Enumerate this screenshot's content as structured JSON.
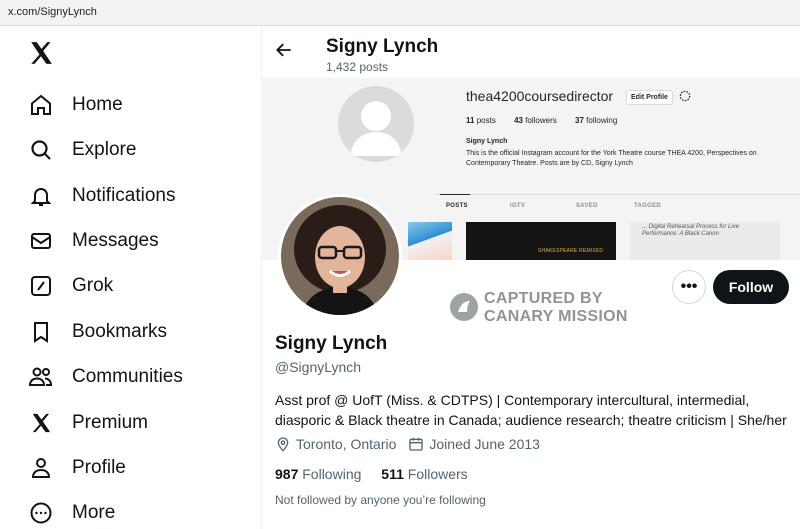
{
  "browser": {
    "url": "x.com/SignyLynch"
  },
  "sidebar": {
    "items": [
      {
        "label": "Home",
        "icon": "home-icon"
      },
      {
        "label": "Explore",
        "icon": "search-icon"
      },
      {
        "label": "Notifications",
        "icon": "bell-icon"
      },
      {
        "label": "Messages",
        "icon": "envelope-icon"
      },
      {
        "label": "Grok",
        "icon": "grok-icon"
      },
      {
        "label": "Bookmarks",
        "icon": "bookmark-icon"
      },
      {
        "label": "Communities",
        "icon": "people-icon"
      },
      {
        "label": "Premium",
        "icon": "x-logo-icon"
      },
      {
        "label": "Profile",
        "icon": "person-icon"
      },
      {
        "label": "More",
        "icon": "more-circle-icon"
      }
    ]
  },
  "header": {
    "name": "Signy Lynch",
    "posts": "1,432 posts"
  },
  "banner": {
    "ig_username": "thea4200coursedirector",
    "ig_edit": "Edit Profile",
    "ig_posts": "11",
    "ig_posts_label": "posts",
    "ig_followers": "43",
    "ig_followers_label": "followers",
    "ig_following": "37",
    "ig_following_label": "following",
    "ig_name": "Signy Lynch",
    "ig_bio": "This is the official Instagram account for the York Theatre course THEA 4200, Perspectives on Contemporary Theatre. Posts are by CD, Signy Lynch",
    "ig_tabs": [
      "POSTS",
      "IGTV",
      "SAVED",
      "TAGGED"
    ],
    "thumb2_text": "SHAKESPEARE REMIXED",
    "thumb3_text": "... Digital Rehearsal Process for Live Performance: A Black Canon"
  },
  "watermark": {
    "line1": "CAPTURED BY",
    "line2": "CANARY MISSION"
  },
  "profile": {
    "follow_label": "Follow",
    "more_label": "•••",
    "name": "Signy Lynch",
    "handle": "@SignyLynch",
    "bio": "Asst prof @ UofT (Miss. & CDTPS) | Contemporary intercultural, intermedial, diasporic & Black theatre in Canada; audience research; theatre criticism | She/her",
    "location": "Toronto, Ontario",
    "joined": "Joined June 2013",
    "following_count": "987",
    "following_label": "Following",
    "followers_count": "511",
    "followers_label": "Followers",
    "not_followed": "Not followed by anyone you’re following"
  },
  "colors": {
    "text": "#0f1419",
    "secondary": "#536471",
    "follow_bg": "#0f1419",
    "border": "#cfd9de"
  }
}
